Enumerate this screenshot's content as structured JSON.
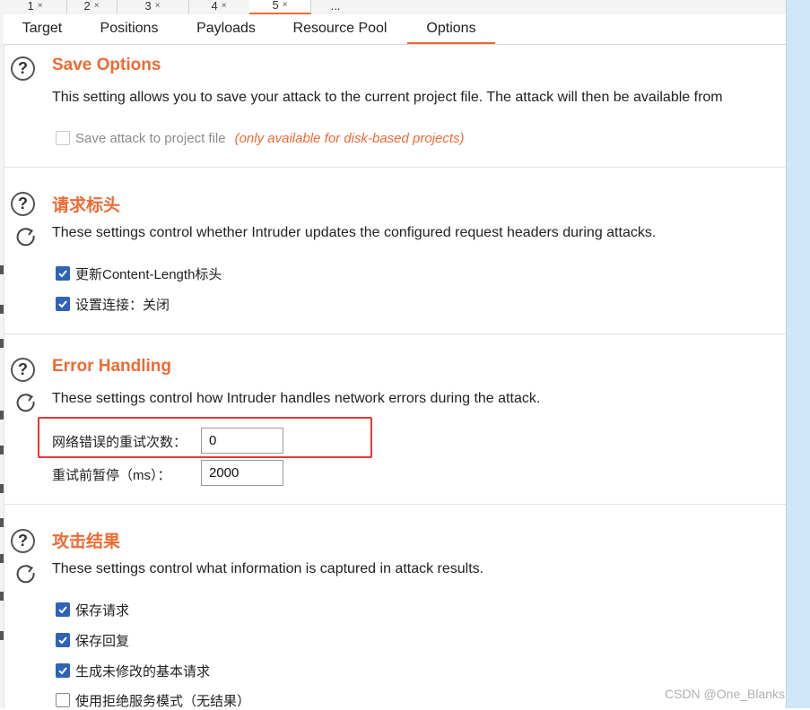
{
  "attack_tabs": [
    {
      "label": "1",
      "close": "×"
    },
    {
      "label": "2",
      "close": "×"
    },
    {
      "label": "3",
      "close": "×"
    },
    {
      "label": "4",
      "close": "×"
    },
    {
      "label": "5",
      "close": "×"
    },
    {
      "label": "..."
    }
  ],
  "tabs": [
    {
      "label": "Target"
    },
    {
      "label": "Positions"
    },
    {
      "label": "Payloads"
    },
    {
      "label": "Resource Pool"
    },
    {
      "label": "Options",
      "active": true
    }
  ],
  "save_options": {
    "title": "Save Options",
    "description": "This setting allows you to save your attack to the current project file. The attack will then be available from",
    "checkbox_label": "Save attack to project file",
    "checkbox_checked": false,
    "note": "(only available for disk-based projects)"
  },
  "request_headers": {
    "title": "请求标头",
    "description": "These settings control whether Intruder updates the configured request headers during attacks.",
    "options": [
      {
        "label": "更新Content-Length标头",
        "checked": true
      },
      {
        "label": "设置连接：关闭",
        "checked": true
      }
    ]
  },
  "error_handling": {
    "title": "Error Handling",
    "description": "These settings control how Intruder handles network errors during the attack.",
    "retries_label": "网络错误的重试次数：",
    "retries_value": "0",
    "pause_label": "重试前暂停（ms）：",
    "pause_value": "2000"
  },
  "attack_results": {
    "title": "攻击结果",
    "description": "These settings control what information is captured in attack results.",
    "options": [
      {
        "label": "保存请求",
        "checked": true
      },
      {
        "label": "保存回复",
        "checked": true
      },
      {
        "label": "生成未修改的基本请求",
        "checked": true
      },
      {
        "label": "使用拒绝服务模式（无结果）",
        "checked": false
      }
    ]
  },
  "icons": {
    "help": "help-circle-icon",
    "restore": "restore-defaults-icon",
    "check": "check-icon"
  },
  "colors": {
    "accent": "#ef6a33",
    "checkbox": "#2d64b8",
    "highlight": "#e53935"
  },
  "watermark": "CSDN @One_Blanks"
}
